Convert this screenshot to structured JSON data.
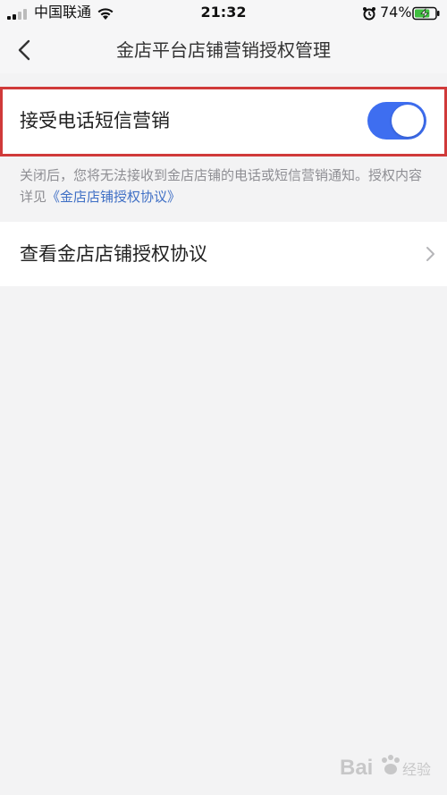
{
  "status_bar": {
    "carrier": "中国联通",
    "time": "21:32",
    "battery_percent": "74%",
    "battery_level": 0.74,
    "icons": [
      "signal-icon",
      "wifi-icon",
      "alarm-icon",
      "battery-charging-icon"
    ]
  },
  "nav": {
    "title": "金店平台店铺营销授权管理",
    "back_icon": "back-chevron-icon"
  },
  "marketing_toggle": {
    "label": "接受电话短信营销",
    "enabled": true,
    "accent_color": "#3e6ef0",
    "highlight_color": "#d03a3a"
  },
  "description": {
    "text": "关闭后，您将无法接收到金店店铺的电话或短信营销通知。授权内容详见",
    "link_text": "《金店店铺授权协议》",
    "link_color": "#3f6fc5"
  },
  "agreement_row": {
    "label": "查看金店店铺授权协议",
    "icon": "chevron-right-icon"
  },
  "watermark": {
    "text": "Bai",
    "text2": "经验",
    "icon": "baidu-paw-icon"
  }
}
